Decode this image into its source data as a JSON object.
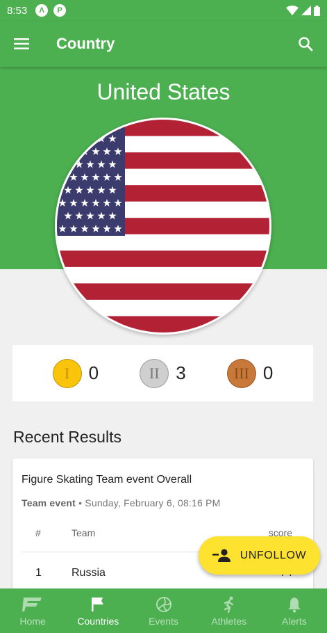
{
  "status_bar": {
    "time": "8:53",
    "icons": [
      "vpn-key-icon",
      "app-notification-icon",
      "wifi-icon",
      "signal-icon",
      "battery-icon"
    ]
  },
  "app_bar": {
    "title": "Country",
    "icons": [
      "menu-icon",
      "search-icon"
    ]
  },
  "country": {
    "name": "United States",
    "flag": "us-flag"
  },
  "medals": [
    {
      "symbol": "I",
      "count": "0",
      "type": "gold",
      "color": "#f9c40a"
    },
    {
      "symbol": "II",
      "count": "3",
      "type": "silver",
      "color": "#cfcfcf"
    },
    {
      "symbol": "III",
      "count": "0",
      "type": "bronze",
      "color": "#c8793a"
    }
  ],
  "recent_results": {
    "heading": "Recent Results",
    "card": {
      "title": "Figure Skating Team event Overall",
      "event_type": "Team event",
      "separator": "•",
      "date": "Sunday, February 6, 08:16 PM",
      "columns": [
        "#",
        "Team",
        "score"
      ],
      "rows": [
        {
          "rank": "1",
          "team": "Russia",
          "score": "74"
        }
      ]
    }
  },
  "fab": {
    "label": "UNFOLLOW",
    "icon": "person-remove-icon"
  },
  "bottom_nav": {
    "items": [
      {
        "label": "Home",
        "icon": "home-logo-icon",
        "active": false
      },
      {
        "label": "Countries",
        "icon": "flag-icon",
        "active": true
      },
      {
        "label": "Events",
        "icon": "volleyball-icon",
        "active": false
      },
      {
        "label": "Athletes",
        "icon": "runner-icon",
        "active": false
      },
      {
        "label": "Alerts",
        "icon": "bell-icon",
        "active": false
      }
    ]
  },
  "colors": {
    "primary": "#4caf50",
    "fab": "#fde22f",
    "background": "#f0f0f0"
  }
}
